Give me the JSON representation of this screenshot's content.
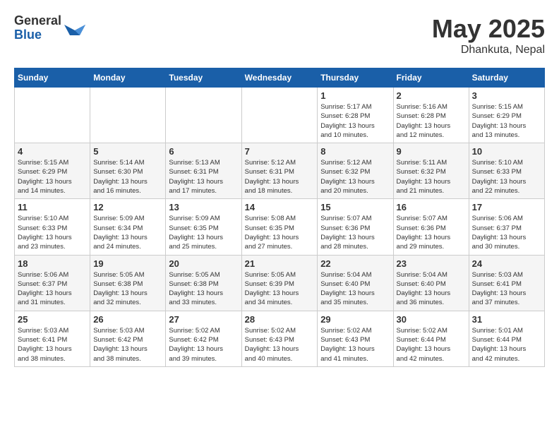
{
  "header": {
    "logo_general": "General",
    "logo_blue": "Blue",
    "month_title": "May 2025",
    "location": "Dhankuta, Nepal"
  },
  "days_of_week": [
    "Sunday",
    "Monday",
    "Tuesday",
    "Wednesday",
    "Thursday",
    "Friday",
    "Saturday"
  ],
  "weeks": [
    [
      {
        "day": "",
        "info": ""
      },
      {
        "day": "",
        "info": ""
      },
      {
        "day": "",
        "info": ""
      },
      {
        "day": "",
        "info": ""
      },
      {
        "day": "1",
        "info": "Sunrise: 5:17 AM\nSunset: 6:28 PM\nDaylight: 13 hours\nand 10 minutes."
      },
      {
        "day": "2",
        "info": "Sunrise: 5:16 AM\nSunset: 6:28 PM\nDaylight: 13 hours\nand 12 minutes."
      },
      {
        "day": "3",
        "info": "Sunrise: 5:15 AM\nSunset: 6:29 PM\nDaylight: 13 hours\nand 13 minutes."
      }
    ],
    [
      {
        "day": "4",
        "info": "Sunrise: 5:15 AM\nSunset: 6:29 PM\nDaylight: 13 hours\nand 14 minutes."
      },
      {
        "day": "5",
        "info": "Sunrise: 5:14 AM\nSunset: 6:30 PM\nDaylight: 13 hours\nand 16 minutes."
      },
      {
        "day": "6",
        "info": "Sunrise: 5:13 AM\nSunset: 6:31 PM\nDaylight: 13 hours\nand 17 minutes."
      },
      {
        "day": "7",
        "info": "Sunrise: 5:12 AM\nSunset: 6:31 PM\nDaylight: 13 hours\nand 18 minutes."
      },
      {
        "day": "8",
        "info": "Sunrise: 5:12 AM\nSunset: 6:32 PM\nDaylight: 13 hours\nand 20 minutes."
      },
      {
        "day": "9",
        "info": "Sunrise: 5:11 AM\nSunset: 6:32 PM\nDaylight: 13 hours\nand 21 minutes."
      },
      {
        "day": "10",
        "info": "Sunrise: 5:10 AM\nSunset: 6:33 PM\nDaylight: 13 hours\nand 22 minutes."
      }
    ],
    [
      {
        "day": "11",
        "info": "Sunrise: 5:10 AM\nSunset: 6:33 PM\nDaylight: 13 hours\nand 23 minutes."
      },
      {
        "day": "12",
        "info": "Sunrise: 5:09 AM\nSunset: 6:34 PM\nDaylight: 13 hours\nand 24 minutes."
      },
      {
        "day": "13",
        "info": "Sunrise: 5:09 AM\nSunset: 6:35 PM\nDaylight: 13 hours\nand 25 minutes."
      },
      {
        "day": "14",
        "info": "Sunrise: 5:08 AM\nSunset: 6:35 PM\nDaylight: 13 hours\nand 27 minutes."
      },
      {
        "day": "15",
        "info": "Sunrise: 5:07 AM\nSunset: 6:36 PM\nDaylight: 13 hours\nand 28 minutes."
      },
      {
        "day": "16",
        "info": "Sunrise: 5:07 AM\nSunset: 6:36 PM\nDaylight: 13 hours\nand 29 minutes."
      },
      {
        "day": "17",
        "info": "Sunrise: 5:06 AM\nSunset: 6:37 PM\nDaylight: 13 hours\nand 30 minutes."
      }
    ],
    [
      {
        "day": "18",
        "info": "Sunrise: 5:06 AM\nSunset: 6:37 PM\nDaylight: 13 hours\nand 31 minutes."
      },
      {
        "day": "19",
        "info": "Sunrise: 5:05 AM\nSunset: 6:38 PM\nDaylight: 13 hours\nand 32 minutes."
      },
      {
        "day": "20",
        "info": "Sunrise: 5:05 AM\nSunset: 6:38 PM\nDaylight: 13 hours\nand 33 minutes."
      },
      {
        "day": "21",
        "info": "Sunrise: 5:05 AM\nSunset: 6:39 PM\nDaylight: 13 hours\nand 34 minutes."
      },
      {
        "day": "22",
        "info": "Sunrise: 5:04 AM\nSunset: 6:40 PM\nDaylight: 13 hours\nand 35 minutes."
      },
      {
        "day": "23",
        "info": "Sunrise: 5:04 AM\nSunset: 6:40 PM\nDaylight: 13 hours\nand 36 minutes."
      },
      {
        "day": "24",
        "info": "Sunrise: 5:03 AM\nSunset: 6:41 PM\nDaylight: 13 hours\nand 37 minutes."
      }
    ],
    [
      {
        "day": "25",
        "info": "Sunrise: 5:03 AM\nSunset: 6:41 PM\nDaylight: 13 hours\nand 38 minutes."
      },
      {
        "day": "26",
        "info": "Sunrise: 5:03 AM\nSunset: 6:42 PM\nDaylight: 13 hours\nand 38 minutes."
      },
      {
        "day": "27",
        "info": "Sunrise: 5:02 AM\nSunset: 6:42 PM\nDaylight: 13 hours\nand 39 minutes."
      },
      {
        "day": "28",
        "info": "Sunrise: 5:02 AM\nSunset: 6:43 PM\nDaylight: 13 hours\nand 40 minutes."
      },
      {
        "day": "29",
        "info": "Sunrise: 5:02 AM\nSunset: 6:43 PM\nDaylight: 13 hours\nand 41 minutes."
      },
      {
        "day": "30",
        "info": "Sunrise: 5:02 AM\nSunset: 6:44 PM\nDaylight: 13 hours\nand 42 minutes."
      },
      {
        "day": "31",
        "info": "Sunrise: 5:01 AM\nSunset: 6:44 PM\nDaylight: 13 hours\nand 42 minutes."
      }
    ]
  ]
}
